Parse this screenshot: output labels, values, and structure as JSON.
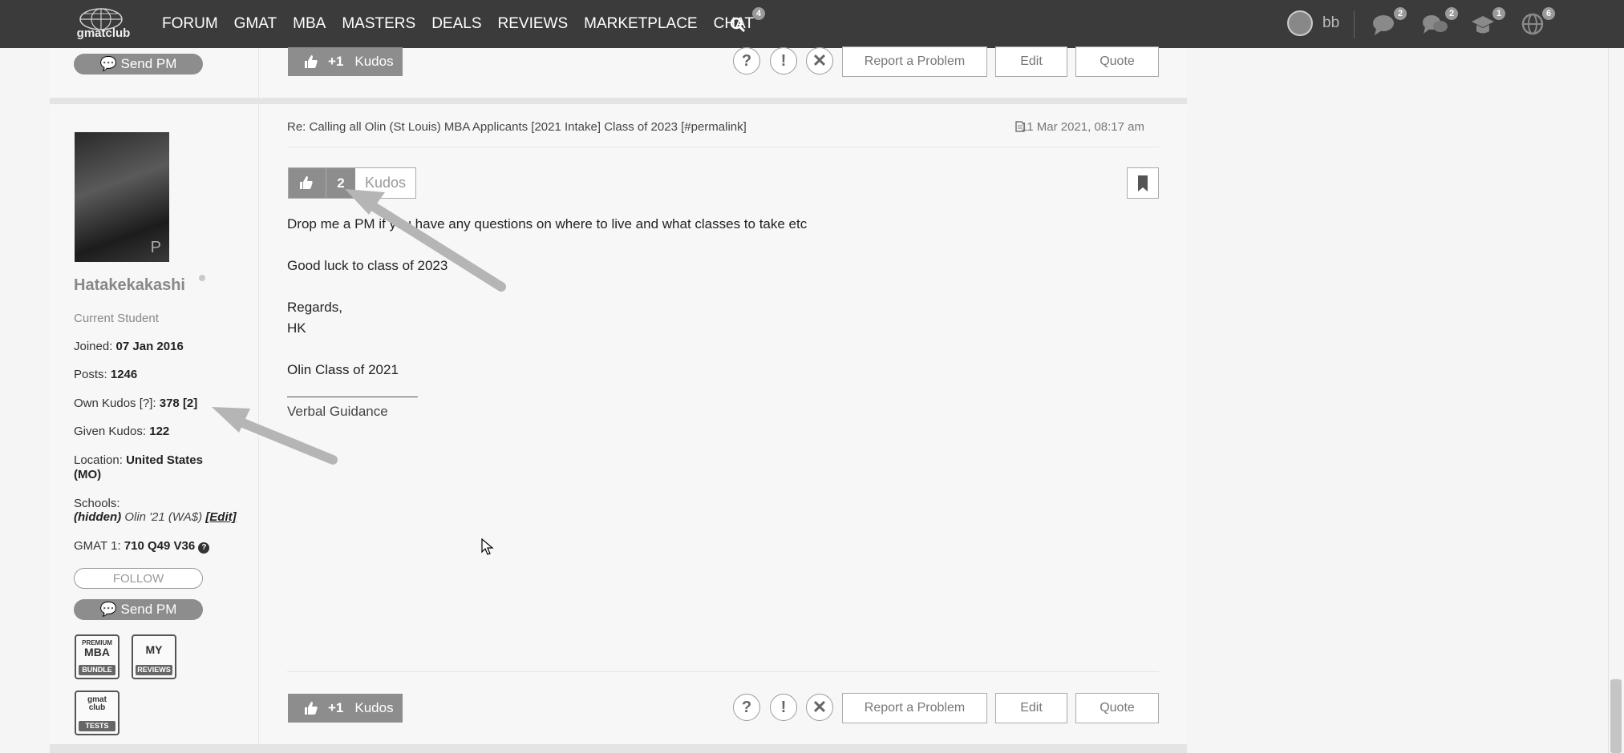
{
  "nav": {
    "items": [
      "FORUM",
      "GMAT",
      "MBA",
      "MASTERS",
      "DEALS",
      "REVIEWS",
      "MARKETPLACE",
      "CHAT"
    ],
    "chat_badge": "4"
  },
  "logo": {
    "text": "gmatclub"
  },
  "user": {
    "name": "bb"
  },
  "notifications": {
    "chat": "2",
    "messages": "2",
    "school": "1",
    "globe": "6"
  },
  "prev_post": {
    "send_pm": "Send PM",
    "kudos_plus": "+1",
    "kudos_label": "Kudos",
    "report": "Report a Problem",
    "edit": "Edit",
    "quote": "Quote"
  },
  "author": {
    "avatar_tag": "P",
    "name": "Hatakekakashi",
    "role": "Current Student",
    "joined_label": "Joined:",
    "joined": "07 Jan 2016",
    "posts_label": "Posts:",
    "posts": "1246",
    "own_kudos_label": "Own Kudos [?]:",
    "own_kudos": "378",
    "own_kudos_extra": "[2]",
    "given_kudos_label": "Given Kudos:",
    "given_kudos": "122",
    "location_label": "Location:",
    "location": "United States (MO)",
    "schools_label": "Schools:",
    "schools_hidden": "(hidden)",
    "schools_value": "Olin '21 (WA$)",
    "schools_edit": "[Edit]",
    "gmat_label": "GMAT 1:",
    "gmat_score": "710 Q49 V36",
    "follow": "FOLLOW",
    "send_pm": "Send PM",
    "products": {
      "premium_top": "PREMIUM",
      "premium_main": "MBA",
      "premium_foot": "BUNDLE",
      "my_main": "MY",
      "my_foot": "REVIEWS",
      "tests_main": "gmat club",
      "tests_foot": "TESTS"
    }
  },
  "post": {
    "title": "Re: Calling all Olin (St Louis) MBA Applicants [2021 Intake] Class of 2023 [#permalink]",
    "date": "11 Mar 2021, 08:17 am",
    "kudos_count": "2",
    "kudos_label": "Kudos",
    "body": [
      "Drop me a PM if you have any questions on where to live and what classes to take etc",
      "Good luck to class of 2023",
      "Regards,",
      "HK",
      "Olin Class of 2021"
    ],
    "signature": "Verbal Guidance",
    "kudos_plus": "+1",
    "kudos_btn_label": "Kudos",
    "report": "Report a Problem",
    "edit": "Edit",
    "quote": "Quote"
  }
}
